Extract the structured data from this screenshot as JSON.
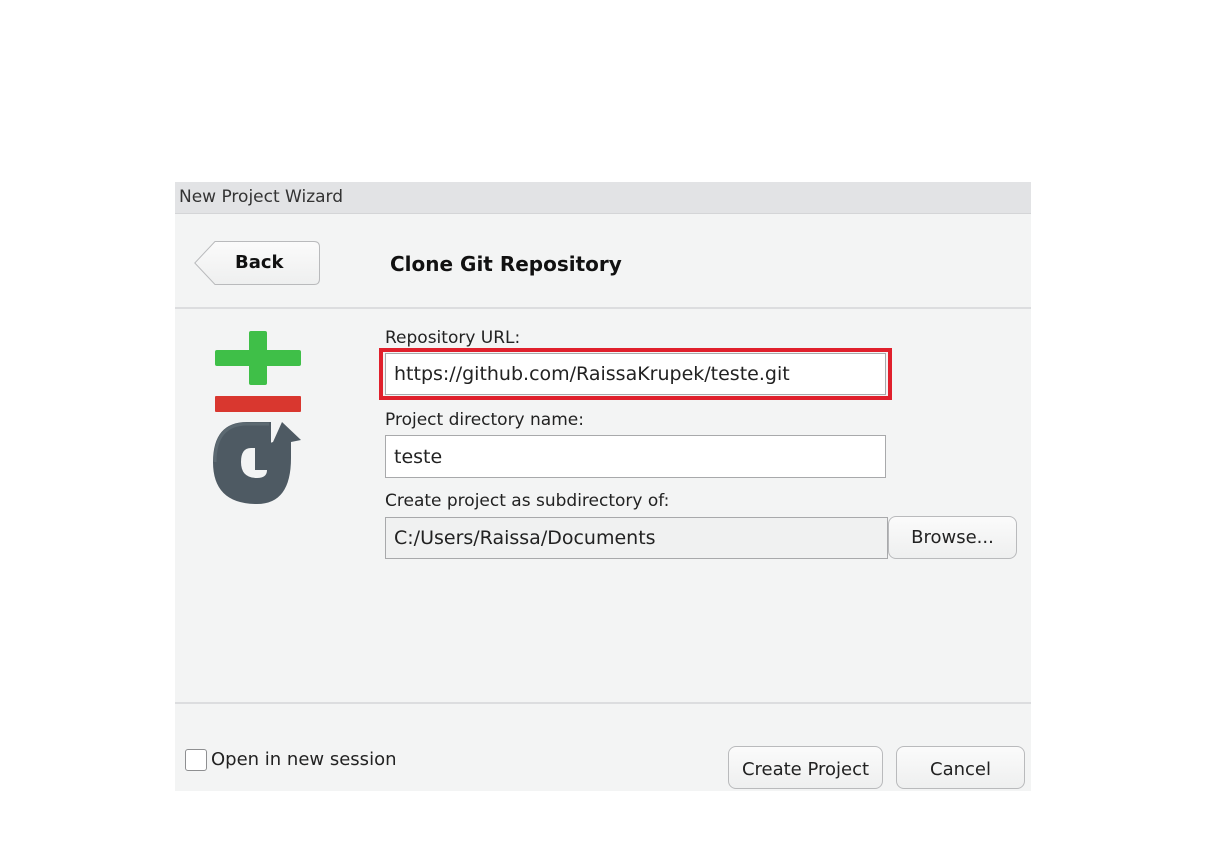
{
  "window": {
    "title": "New Project Wizard"
  },
  "header": {
    "back_label": "Back",
    "page_title": "Clone Git Repository"
  },
  "form": {
    "repo_url_label": "Repository URL:",
    "repo_url_value": "https://github.com/RaissaKrupek/teste.git",
    "dir_name_label": "Project directory name:",
    "dir_name_value": "teste",
    "subdir_label": "Create project as subdirectory of:",
    "subdir_value": "C:/Users/Raissa/Documents",
    "browse_label": "Browse..."
  },
  "footer": {
    "open_new_session_label": "Open in new session",
    "open_new_session_checked": false,
    "create_project_label": "Create Project",
    "cancel_label": "Cancel"
  },
  "icons": {
    "logo": "git-logo-icon"
  },
  "colors": {
    "highlight": "#e0202c",
    "git_plus": "#3fbf48",
    "git_minus": "#d9372f",
    "git_g": "#4e5a63"
  }
}
